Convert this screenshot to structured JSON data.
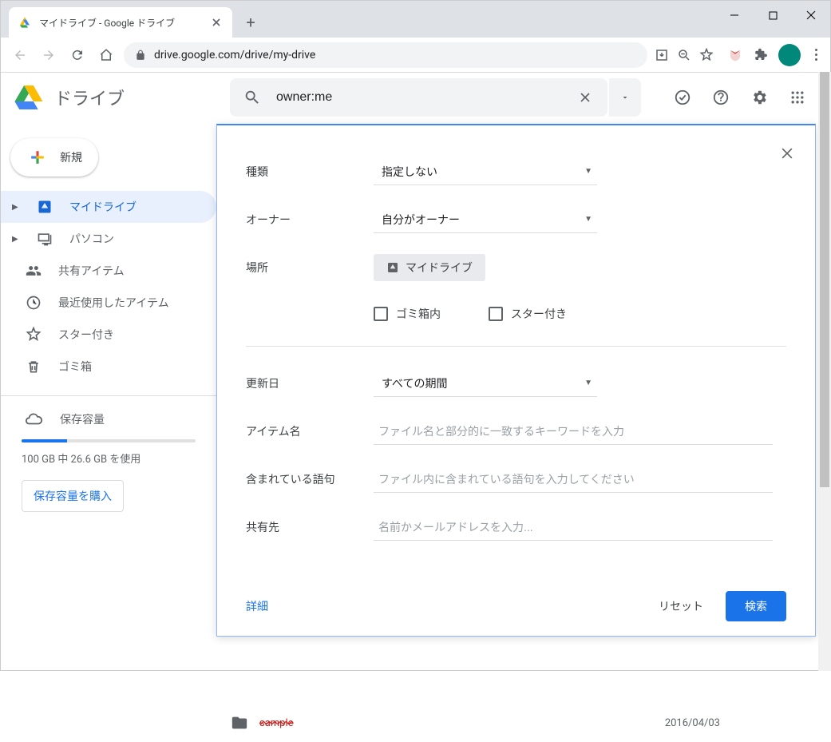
{
  "browser": {
    "tab_title": "マイドライブ - Google ドライブ",
    "url_display": "drive.google.com/drive/my-drive"
  },
  "drive": {
    "app_title": "ドライブ",
    "new_button": "新規",
    "search_value": "owner:me"
  },
  "sidebar": {
    "items": [
      {
        "label": "マイドライブ"
      },
      {
        "label": "パソコン"
      },
      {
        "label": "共有アイテム"
      },
      {
        "label": "最近使用したアイテム"
      },
      {
        "label": "スター付き"
      },
      {
        "label": "ゴミ箱"
      }
    ],
    "storage_label": "保存容量",
    "storage_text": "100 GB 中 26.6 GB を使用",
    "buy_label": "保存容量を購入"
  },
  "filter": {
    "type_label": "種類",
    "type_value": "指定しない",
    "owner_label": "オーナー",
    "owner_value": "自分がオーナー",
    "location_label": "場所",
    "location_chip": "マイドライブ",
    "trash_checkbox": "ゴミ箱内",
    "starred_checkbox": "スター付き",
    "modified_label": "更新日",
    "modified_value": "すべての期間",
    "itemname_label": "アイテム名",
    "itemname_placeholder": "ファイル名と部分的に一致するキーワードを入力",
    "contains_label": "含まれている語句",
    "contains_placeholder": "ファイル内に含まれている語句を入力してください",
    "shared_label": "共有先",
    "shared_placeholder": "名前かメールアドレスを入力...",
    "details_link": "詳細",
    "reset_button": "リセット",
    "search_button": "検索"
  },
  "file": {
    "name": "sample",
    "date": "2016/04/03"
  }
}
